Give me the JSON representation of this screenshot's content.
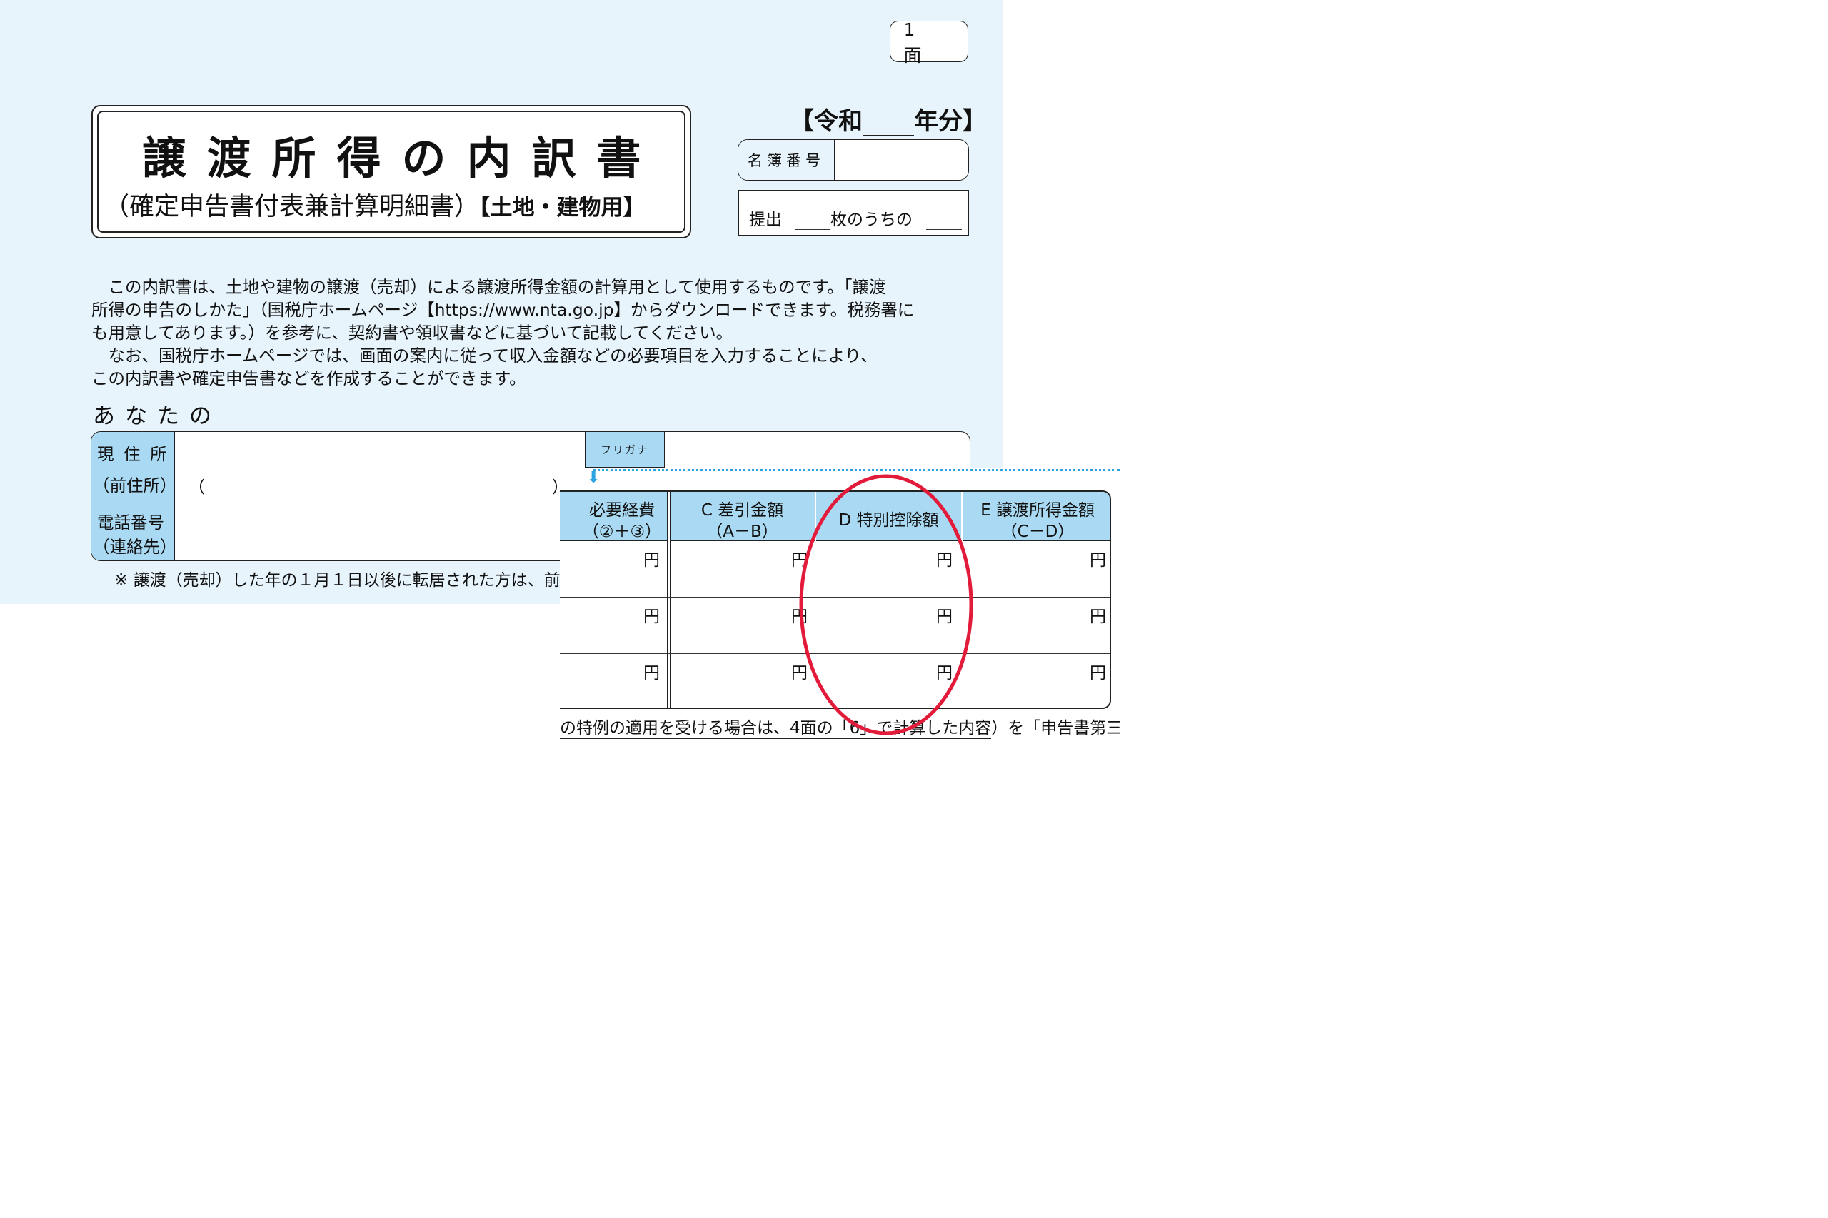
{
  "page_badge": "1　面",
  "title": {
    "main": "譲渡所得の内訳書",
    "sub_prefix": "（確定申告書付表兼計算明細書）",
    "sub_suffix": "【土地・建物用】"
  },
  "year_label_prefix": "【令和",
  "year_label_suffix": "年分】",
  "roll_number_label": "名簿番号",
  "submission": {
    "t1": "提出",
    "t2": "枚のうちの"
  },
  "intro_lines": [
    "　この内訳書は、土地や建物の譲渡（売却）による譲渡所得金額の計算用として使用するものです。「譲渡",
    "所得の申告のしかた」（国税庁ホームページ【https://www.nta.go.jp】からダウンロードできます。税務署に",
    "も用意してあります。）を参考に、契約書や領収書などに基づいて記載してください。",
    "　なお、国税庁ホームページでは、画面の案内に従って収入金額などの必要項目を入力することにより、",
    "この内訳書や確定申告書などを作成することができます。"
  ],
  "section_anata": "あなたの",
  "address": {
    "label1": "現 住 所",
    "label2": "（前住所）",
    "paren_open": "（",
    "paren_close": "）",
    "furigana": "フリガナ"
  },
  "phone": {
    "label1": "電話番号",
    "label2": "（連絡先）"
  },
  "footnote": "※ 譲渡（売却）した年の１月１日以後に転居された方は、前",
  "table": {
    "headers": [
      {
        "l1": "必要経費",
        "l2": "（②＋③）"
      },
      {
        "l1": "C 差引金額",
        "l2": "（A－B）"
      },
      {
        "l1": "D 特別控除額",
        "l2": ""
      },
      {
        "l1": "E 譲渡所得金額",
        "l2": "（C－D）"
      }
    ],
    "unit": "円",
    "rows": 3
  },
  "bottom_note": {
    "before": "の特例の適用を受ける場合は、4面の「6」で計算した内容",
    "after": "）を「申告書第三"
  },
  "colors": {
    "background": "#e8f4fc",
    "header_fill": "#aadaf3",
    "highlight_ellipse": "#e31b3a",
    "guide_dots": "#2ba3e0"
  }
}
